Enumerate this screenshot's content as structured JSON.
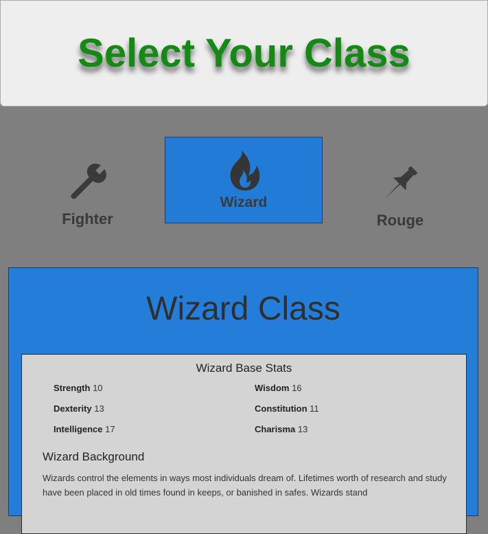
{
  "header": {
    "title": "Select Your Class"
  },
  "class_options": [
    {
      "label": "Fighter",
      "icon": "wrench-icon",
      "selected": false
    },
    {
      "label": "Wizard",
      "icon": "fire-icon",
      "selected": true
    },
    {
      "label": "Rouge",
      "icon": "pushpin-icon",
      "selected": false
    }
  ],
  "panel": {
    "title": "Wizard Class",
    "stats_title": "Wizard Base Stats",
    "stats": [
      {
        "name": "Strength",
        "value": "10"
      },
      {
        "name": "Wisdom",
        "value": "16"
      },
      {
        "name": "Dexterity",
        "value": "13"
      },
      {
        "name": "Constitution",
        "value": "11"
      },
      {
        "name": "Intelligence",
        "value": "17"
      },
      {
        "name": "Charisma",
        "value": "13"
      }
    ],
    "background_title": "Wizard Background",
    "background_text": "Wizards control the elements in ways most individuals dream of. Lifetimes worth of research and study have been placed in old times found in keeps, or banished in safes. Wizards stand"
  },
  "colors": {
    "page_bg": "#7f7f7f",
    "header_bg": "#eeeeee",
    "title_green": "#148a14",
    "selected_blue": "#237bd8",
    "panel_blue": "#247ed9",
    "stats_bg": "#d4d4d4",
    "icon_dark": "#3a3a3a"
  }
}
